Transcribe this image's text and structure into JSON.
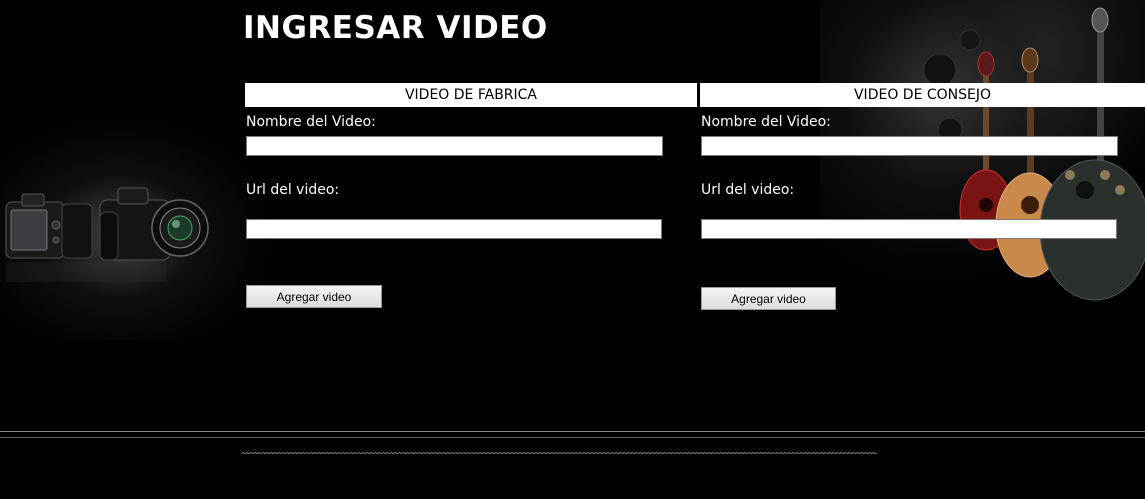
{
  "page": {
    "title": "INGRESAR VIDEO"
  },
  "decor": {
    "left_image": "camera-image",
    "right_image": "guitars-image"
  },
  "sections": {
    "fabrica": {
      "header": "VIDEO DE FABRICA",
      "name_label": "Nombre del Video:",
      "name_value": "",
      "url_label": "Url del video:",
      "url_value": "",
      "button_label": "Agregar video"
    },
    "consejo": {
      "header": "VIDEO DE CONSEJO",
      "name_label": "Nombre del Video:",
      "name_value": "",
      "url_label": "Url del video:",
      "url_value": "",
      "button_label": "Agregar video"
    }
  },
  "footer": {
    "text": "~~~~~~~~~~~~~~~~~~~~~~~~~~~~~~~~~~~~~~~~~~~~~~~~~~~~~~~~~~~~~~~~~~~~~~~~~~~~~~~~~~~~~~~~~~~~~~~~~~~~~~~~~~~~~~~~~~~~~~~~~~~~~~~~~~~~~~~~~~~~~~~~~~~~~~~~~~~~~~"
  },
  "colors": {
    "background": "#000000",
    "header_bg": "#ffffff",
    "text": "#ffffff"
  }
}
